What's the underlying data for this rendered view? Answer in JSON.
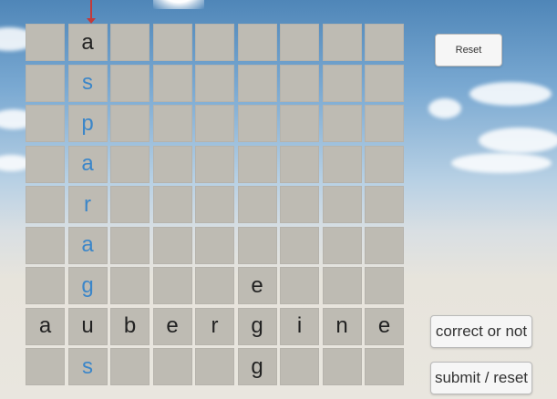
{
  "buttons": {
    "reset": "Reset",
    "correct": "correct or not",
    "submit": "submit / reset"
  },
  "grid": {
    "rows": [
      [
        {
          "t": "",
          "c": ""
        },
        {
          "t": "a",
          "c": "black"
        },
        {
          "t": "",
          "c": ""
        },
        {
          "t": "",
          "c": ""
        },
        {
          "t": "",
          "c": ""
        },
        {
          "t": "",
          "c": ""
        },
        {
          "t": "",
          "c": ""
        },
        {
          "t": "",
          "c": ""
        },
        {
          "t": "",
          "c": ""
        }
      ],
      [
        {
          "t": "",
          "c": ""
        },
        {
          "t": "s",
          "c": "blue"
        },
        {
          "t": "",
          "c": ""
        },
        {
          "t": "",
          "c": ""
        },
        {
          "t": "",
          "c": ""
        },
        {
          "t": "",
          "c": ""
        },
        {
          "t": "",
          "c": ""
        },
        {
          "t": "",
          "c": ""
        },
        {
          "t": "",
          "c": ""
        }
      ],
      [
        {
          "t": "",
          "c": ""
        },
        {
          "t": "p",
          "c": "blue"
        },
        {
          "t": "",
          "c": ""
        },
        {
          "t": "",
          "c": ""
        },
        {
          "t": "",
          "c": ""
        },
        {
          "t": "",
          "c": ""
        },
        {
          "t": "",
          "c": ""
        },
        {
          "t": "",
          "c": ""
        },
        {
          "t": "",
          "c": ""
        }
      ],
      [
        {
          "t": "",
          "c": ""
        },
        {
          "t": "a",
          "c": "blue"
        },
        {
          "t": "",
          "c": ""
        },
        {
          "t": "",
          "c": ""
        },
        {
          "t": "",
          "c": ""
        },
        {
          "t": "",
          "c": ""
        },
        {
          "t": "",
          "c": ""
        },
        {
          "t": "",
          "c": ""
        },
        {
          "t": "",
          "c": ""
        }
      ],
      [
        {
          "t": "",
          "c": ""
        },
        {
          "t": "r",
          "c": "blue"
        },
        {
          "t": "",
          "c": ""
        },
        {
          "t": "",
          "c": ""
        },
        {
          "t": "",
          "c": ""
        },
        {
          "t": "",
          "c": ""
        },
        {
          "t": "",
          "c": ""
        },
        {
          "t": "",
          "c": ""
        },
        {
          "t": "",
          "c": ""
        }
      ],
      [
        {
          "t": "",
          "c": ""
        },
        {
          "t": "a",
          "c": "blue"
        },
        {
          "t": "",
          "c": ""
        },
        {
          "t": "",
          "c": ""
        },
        {
          "t": "",
          "c": ""
        },
        {
          "t": "",
          "c": ""
        },
        {
          "t": "",
          "c": ""
        },
        {
          "t": "",
          "c": ""
        },
        {
          "t": "",
          "c": ""
        }
      ],
      [
        {
          "t": "",
          "c": ""
        },
        {
          "t": "g",
          "c": "blue"
        },
        {
          "t": "",
          "c": ""
        },
        {
          "t": "",
          "c": ""
        },
        {
          "t": "",
          "c": ""
        },
        {
          "t": "e",
          "c": "black"
        },
        {
          "t": "",
          "c": ""
        },
        {
          "t": "",
          "c": ""
        },
        {
          "t": "",
          "c": ""
        }
      ],
      [
        {
          "t": "a",
          "c": "black"
        },
        {
          "t": "u",
          "c": "black"
        },
        {
          "t": "b",
          "c": "black"
        },
        {
          "t": "e",
          "c": "black"
        },
        {
          "t": "r",
          "c": "black"
        },
        {
          "t": "g",
          "c": "black"
        },
        {
          "t": "i",
          "c": "black"
        },
        {
          "t": "n",
          "c": "black"
        },
        {
          "t": "e",
          "c": "black"
        }
      ],
      [
        {
          "t": "",
          "c": ""
        },
        {
          "t": "s",
          "c": "blue"
        },
        {
          "t": "",
          "c": ""
        },
        {
          "t": "",
          "c": ""
        },
        {
          "t": "",
          "c": ""
        },
        {
          "t": "g",
          "c": "black"
        },
        {
          "t": "",
          "c": ""
        },
        {
          "t": "",
          "c": ""
        },
        {
          "t": "",
          "c": ""
        }
      ]
    ]
  },
  "colors": {
    "tile": "#bebbb3",
    "letter_dark": "#222222",
    "letter_blue": "#3b86c9",
    "arrow": "#c33a3a"
  }
}
